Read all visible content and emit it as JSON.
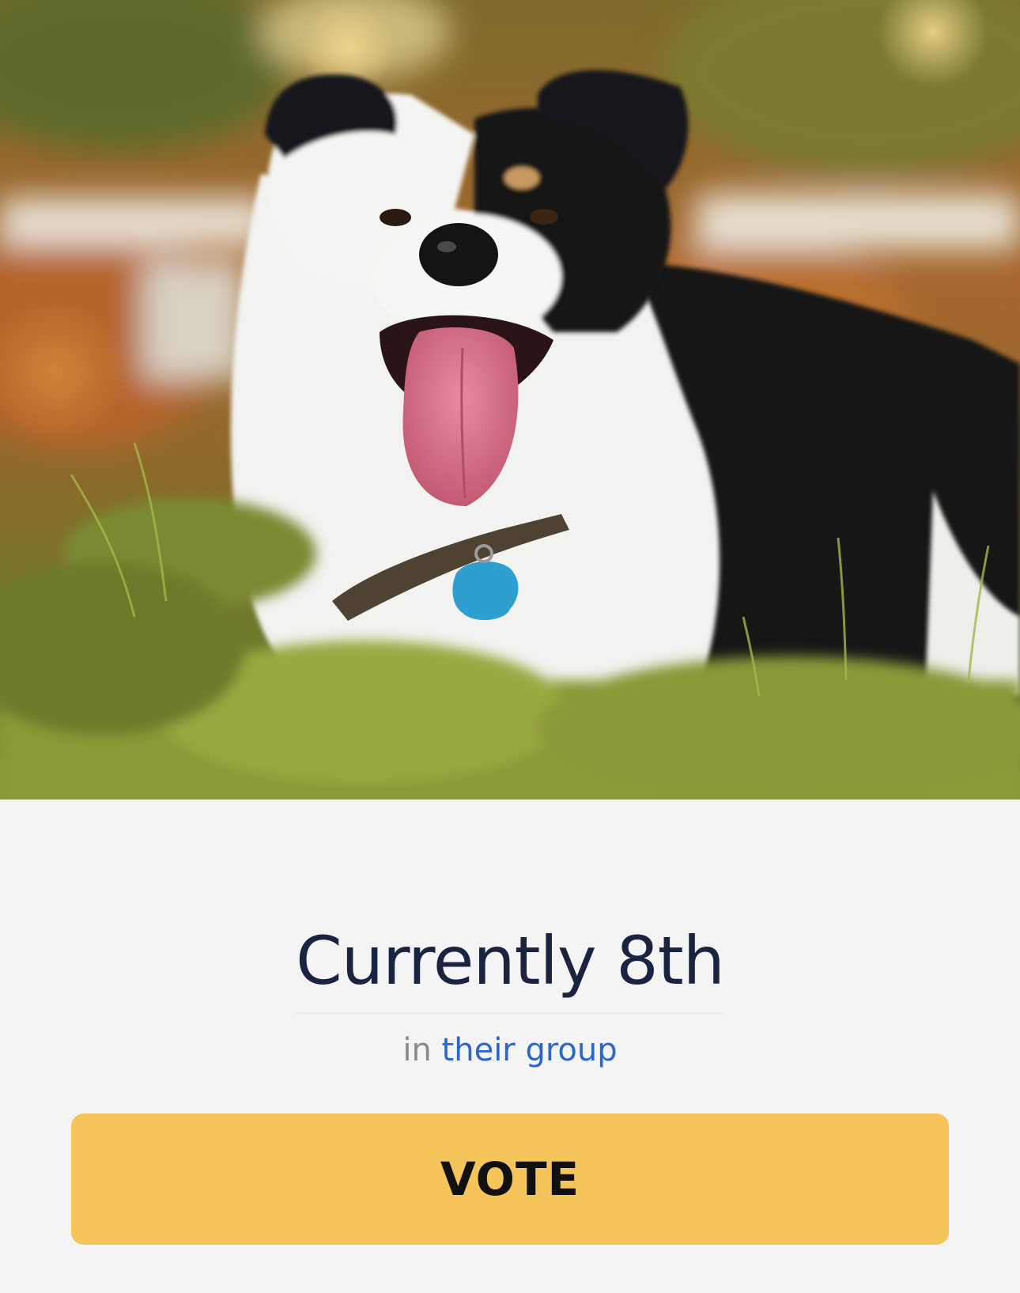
{
  "entry": {
    "photo_subject": "dog-photo",
    "rank_text": "Currently 8th",
    "context_prefix": "in",
    "context_link": "their group"
  },
  "actions": {
    "vote_label": "VOTE"
  },
  "colors": {
    "background": "#f4f4f4",
    "title": "#1a2340",
    "link": "#2b66cc",
    "muted": "#8a8a8a",
    "vote_button": "#f5c45a"
  }
}
